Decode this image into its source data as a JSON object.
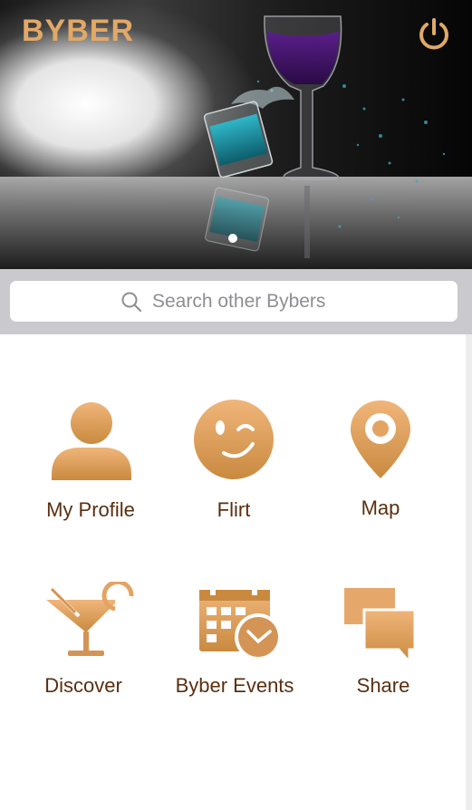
{
  "app": {
    "logo_text": "BYBER",
    "brand_color": "#e1a867",
    "icon_color_top": "#f0b57a",
    "icon_color_bottom": "#c98a3f",
    "label_color": "#5a2f0f"
  },
  "header": {
    "power_icon": "power-icon",
    "carousel": {
      "slides_visible": 1,
      "active_index": 0
    }
  },
  "search": {
    "placeholder": "Search other Bybers",
    "icon": "search-icon"
  },
  "menu": [
    {
      "label": "My Profile",
      "icon": "person-icon"
    },
    {
      "label": "Flirt",
      "icon": "wink-face-icon"
    },
    {
      "label": "Map",
      "icon": "map-pin-icon"
    },
    {
      "label": "Discover",
      "icon": "cocktail-icon"
    },
    {
      "label": "Byber Events",
      "icon": "calendar-clock-icon"
    },
    {
      "label": "Share",
      "icon": "chat-bubbles-icon"
    }
  ]
}
